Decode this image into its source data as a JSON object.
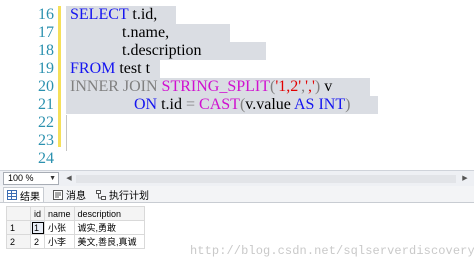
{
  "editor": {
    "line_numbers": [
      "16",
      "17",
      "18",
      "19",
      "20",
      "21",
      "22",
      "23",
      "24"
    ],
    "code": {
      "l16_kw": "SELECT",
      "l16_rest": " t.id,",
      "l17_rest": "t.name,",
      "l18_rest": "t.description",
      "l19_kw": "FROM",
      "l19_rest": " test t",
      "l20_join": "INNER JOIN ",
      "l20_fn": "STRING_SPLIT",
      "l20_open": "(",
      "l20_str1": "'1,2'",
      "l20_comma": ",",
      "l20_str2": "','",
      "l20_close": ")",
      "l20_alias": " v",
      "l21_on": "ON",
      "l21_a": " t.id ",
      "l21_eq": "=",
      "l21_sp": " ",
      "l21_fn": "CAST",
      "l21_open": "(",
      "l21_b": "v.value ",
      "l21_as": "AS",
      "l21_sp2": " ",
      "l21_int": "INT",
      "l21_close": ")"
    }
  },
  "zoom": {
    "value": "100 %"
  },
  "tabs": [
    {
      "label": "结果",
      "icon": "grid-icon"
    },
    {
      "label": "消息",
      "icon": "message-icon"
    },
    {
      "label": "执行计划",
      "icon": "execution-plan-icon"
    }
  ],
  "results": {
    "columns": [
      "id",
      "name",
      "description"
    ],
    "rows": [
      {
        "rownum": "1",
        "id": "1",
        "name": "小张",
        "description": "诚实,勇敢"
      },
      {
        "rownum": "2",
        "id": "2",
        "name": "小李",
        "description": "美文,善良,真诚"
      }
    ]
  },
  "watermark": "http://blog.csdn.net/sqlserverdiscovery",
  "colors": {
    "keyword": "#1515f0",
    "function": "#d010d0",
    "string": "#e20000",
    "operator": "#808080",
    "line_number": "#2b91af",
    "selection": "#dadde3"
  }
}
